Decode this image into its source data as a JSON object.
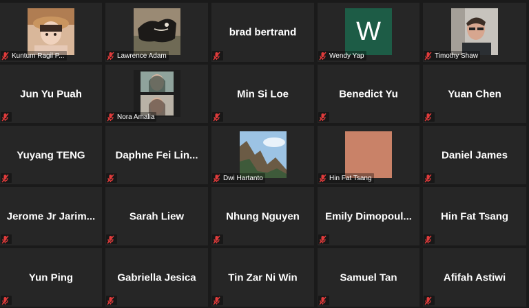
{
  "participants": [
    {
      "name": "Kuntum Ragil P...",
      "mode": "thumb",
      "thumb": "photo-kid"
    },
    {
      "name": "Lawrence Adam",
      "mode": "thumb",
      "thumb": "photo-dog"
    },
    {
      "name": "brad bertrand",
      "mode": "name"
    },
    {
      "name": "Wendy Yap",
      "mode": "thumb",
      "thumb": "letter",
      "letter": "W",
      "color": "#1d5c46"
    },
    {
      "name": "Timothy Shaw",
      "mode": "thumb",
      "thumb": "photo-man"
    },
    {
      "name": "Jun Yu Puah",
      "mode": "name"
    },
    {
      "name": "Nora Amalia",
      "mode": "thumb",
      "thumb": "photo-women"
    },
    {
      "name": "Min Si Loe",
      "mode": "name"
    },
    {
      "name": "Benedict Yu",
      "mode": "name"
    },
    {
      "name": "Yuan Chen",
      "mode": "name"
    },
    {
      "name": "Yuyang TENG",
      "mode": "name"
    },
    {
      "name": "Daphne Fei Lin...",
      "mode": "name"
    },
    {
      "name": "Dwi Hartanto",
      "mode": "thumb",
      "thumb": "photo-cliff"
    },
    {
      "name": "Hin Fat Tsang",
      "mode": "thumb",
      "thumb": "color",
      "color": "#c98268"
    },
    {
      "name": "Daniel James",
      "mode": "name"
    },
    {
      "name": "Jerome Jr Jarim...",
      "mode": "name",
      "ext": true
    },
    {
      "name": "Sarah Liew",
      "mode": "name"
    },
    {
      "name": "Nhung Nguyen",
      "mode": "name"
    },
    {
      "name": "Emily Dimopoul...",
      "mode": "name"
    },
    {
      "name": "Hin Fat Tsang",
      "mode": "name"
    },
    {
      "name": "Yun Ping",
      "mode": "name"
    },
    {
      "name": "Gabriella Jesica",
      "mode": "name"
    },
    {
      "name": "Tin Zar Ni Win",
      "mode": "name"
    },
    {
      "name": "Samuel Tan",
      "mode": "name"
    },
    {
      "name": "Afifah Astiwi",
      "mode": "name"
    }
  ],
  "icons": {
    "mute": "muted-microphone-icon"
  },
  "colors": {
    "tile": "#262626",
    "background": "#1a1a1a",
    "mute_red": "#e03b3b"
  }
}
